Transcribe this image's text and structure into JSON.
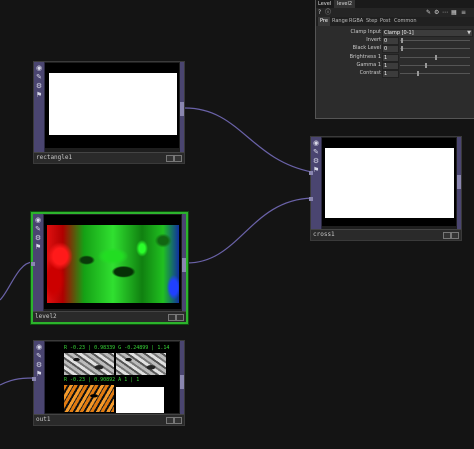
{
  "panel": {
    "header_label": "Level",
    "header_name": "level2",
    "icons": [
      "help-icon",
      "info-icon",
      "pencil-icon",
      "gear-icon",
      "dots-icon",
      "layout-icon",
      "menu-icon"
    ],
    "tabs": [
      "Pre",
      "Range",
      "RGBA",
      "Step",
      "Post",
      "Common"
    ],
    "active_tab": "Pre",
    "params": {
      "clamp_input": {
        "label": "Clamp Input",
        "value": "Clamp [0-1]"
      },
      "invert": {
        "label": "Invert",
        "value": "0"
      },
      "black_level": {
        "label": "Black Level",
        "value": "0"
      },
      "brightness": {
        "label": "Brightness 1",
        "value": "1"
      },
      "gamma": {
        "label": "Gamma 1",
        "value": "1"
      },
      "contrast": {
        "label": "Contrast",
        "value": "1"
      }
    }
  },
  "nodes": {
    "rectangle1": {
      "name": "rectangle1"
    },
    "cross1": {
      "name": "cross1"
    },
    "level2": {
      "name": "level2"
    },
    "out1": {
      "name": "out1",
      "readout_top": "R -0.23 | 0.98339 G -0.24899 | 1.14",
      "readout_mid": "R -0.23 | 0.90892 A 1 | 1"
    }
  },
  "colors": {
    "selection": "#2cb32c",
    "wire": "#6a62a8",
    "sidebar": "#4a4570"
  }
}
